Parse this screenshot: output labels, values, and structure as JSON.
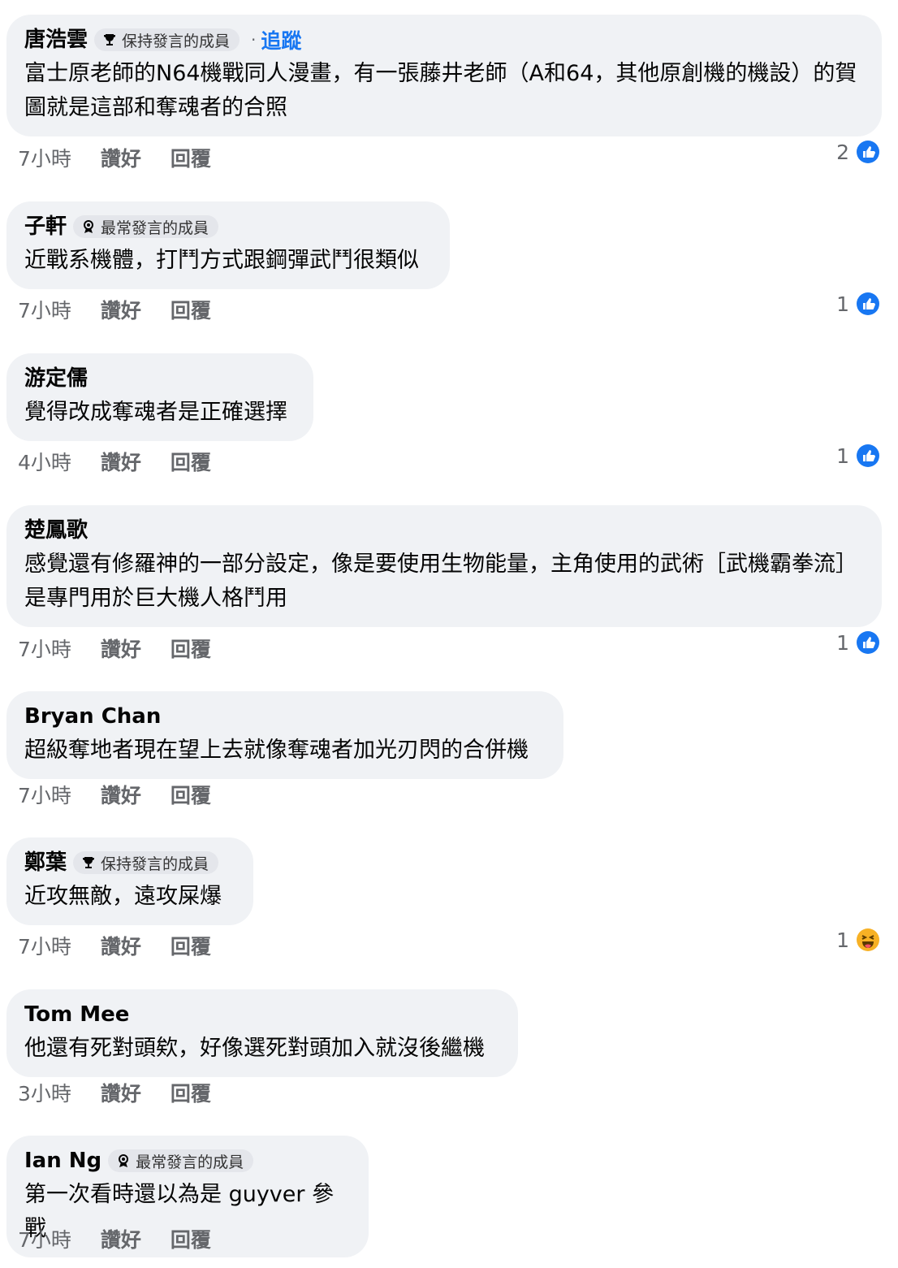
{
  "badges": {
    "keep": "保持發言的成員",
    "top": "最常發言的成員"
  },
  "follow_label": "追蹤",
  "comments": [
    {
      "author": "唐浩雲",
      "text": "富士原老師的N64機戰同人漫畫，有一張藤井老師（A和64，其他原創機的機設）的賀圖就是這部和奪魂者的合照",
      "time": "7小時",
      "like": "讚好",
      "reply": "回覆",
      "count": "2"
    },
    {
      "author": "子軒",
      "text": "近戰系機體，打鬥方式跟鋼彈武鬥很類似",
      "time": "7小時",
      "like": "讚好",
      "reply": "回覆",
      "count": "1"
    },
    {
      "author": "游定儒",
      "text": "覺得改成奪魂者是正確選擇",
      "time": "4小時",
      "like": "讚好",
      "reply": "回覆",
      "count": "1"
    },
    {
      "author": "楚鳳歌",
      "text": "感覺還有修羅神的一部分設定，像是要使用生物能量，主角使用的武術［武機霸拳流］是專門用於巨大機人格鬥用",
      "time": "7小時",
      "like": "讚好",
      "reply": "回覆",
      "count": "1"
    },
    {
      "author": "Bryan Chan",
      "text": "超級奪地者現在望上去就像奪魂者加光刃閃的合併機",
      "time": "7小時",
      "like": "讚好",
      "reply": "回覆"
    },
    {
      "author": "鄭葉",
      "text": "近攻無敵，遠攻屎爆",
      "time": "7小時",
      "like": "讚好",
      "reply": "回覆",
      "count": "1"
    },
    {
      "author": "Tom Mee",
      "text": "他還有死對頭欸，好像選死對頭加入就沒後繼機",
      "time": "3小時",
      "like": "讚好",
      "reply": "回覆"
    },
    {
      "author": "Ian Ng",
      "text": "第一次看時還以為是 guyver 參戰",
      "time": "7小時",
      "like": "讚好",
      "reply": "回覆"
    }
  ],
  "colors": {
    "like_blue": "#1877f2",
    "bubble": "#f0f2f5",
    "meta": "#65676b"
  }
}
